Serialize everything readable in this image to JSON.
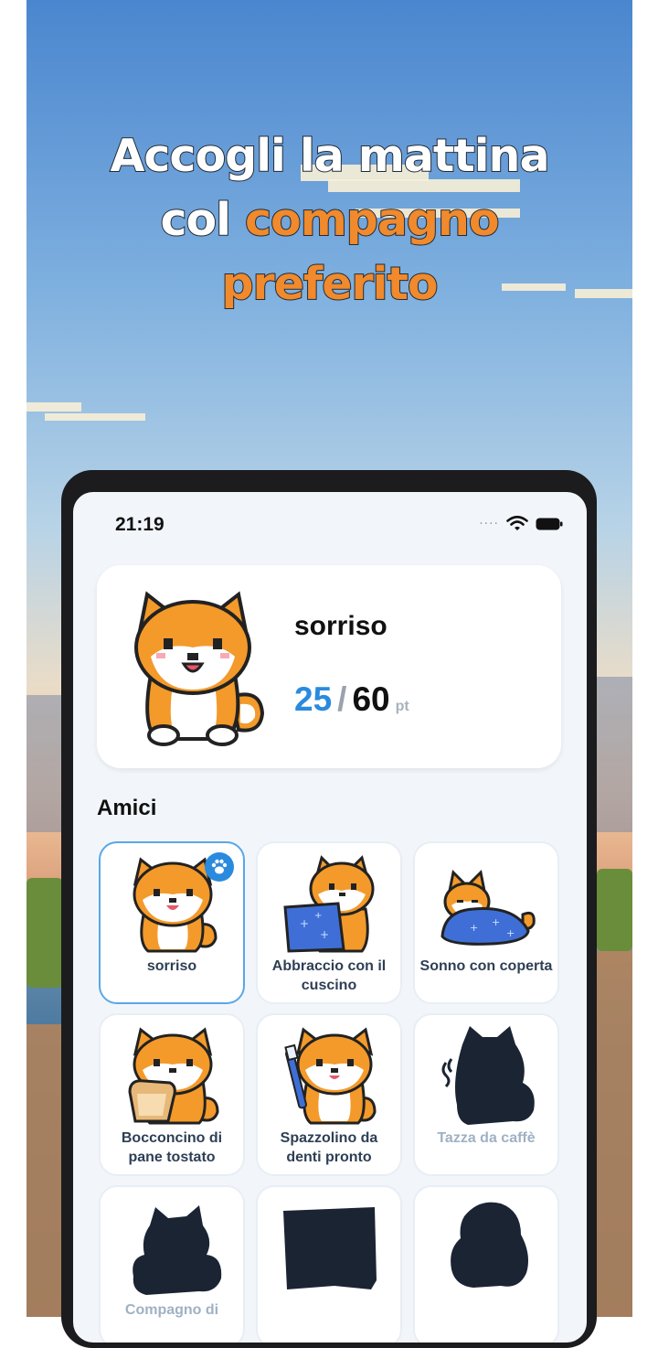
{
  "headline": {
    "line1": "Accogli la mattina",
    "line2_prefix": "col ",
    "line2_highlight": "compagno",
    "line3": "preferito",
    "highlight_color": "#f08a2c"
  },
  "status_bar": {
    "time": "21:19",
    "icons": [
      "signal-icon",
      "wifi-icon",
      "battery-icon"
    ]
  },
  "profile": {
    "name": "sorriso",
    "points_current": "25",
    "points_separator": "/",
    "points_max": "60",
    "points_unit": "pt",
    "accent_color": "#2a8bde"
  },
  "friends": {
    "title": "Amici",
    "items": [
      {
        "label": "sorriso",
        "unlocked": true,
        "selected": true,
        "icon": "paw-icon"
      },
      {
        "label": "Abbraccio con il cuscino",
        "unlocked": true,
        "selected": false
      },
      {
        "label": "Sonno con coperta",
        "unlocked": true,
        "selected": false
      },
      {
        "label": "Bocconcino di pane tostato",
        "unlocked": true,
        "selected": false
      },
      {
        "label": "Spazzolino da denti pronto",
        "unlocked": true,
        "selected": false
      },
      {
        "label": "Tazza da caffè",
        "unlocked": false,
        "selected": false
      },
      {
        "label": "Compagno di",
        "unlocked": false,
        "selected": false
      },
      {
        "label": "",
        "unlocked": false,
        "selected": false
      },
      {
        "label": "",
        "unlocked": false,
        "selected": false
      }
    ]
  }
}
